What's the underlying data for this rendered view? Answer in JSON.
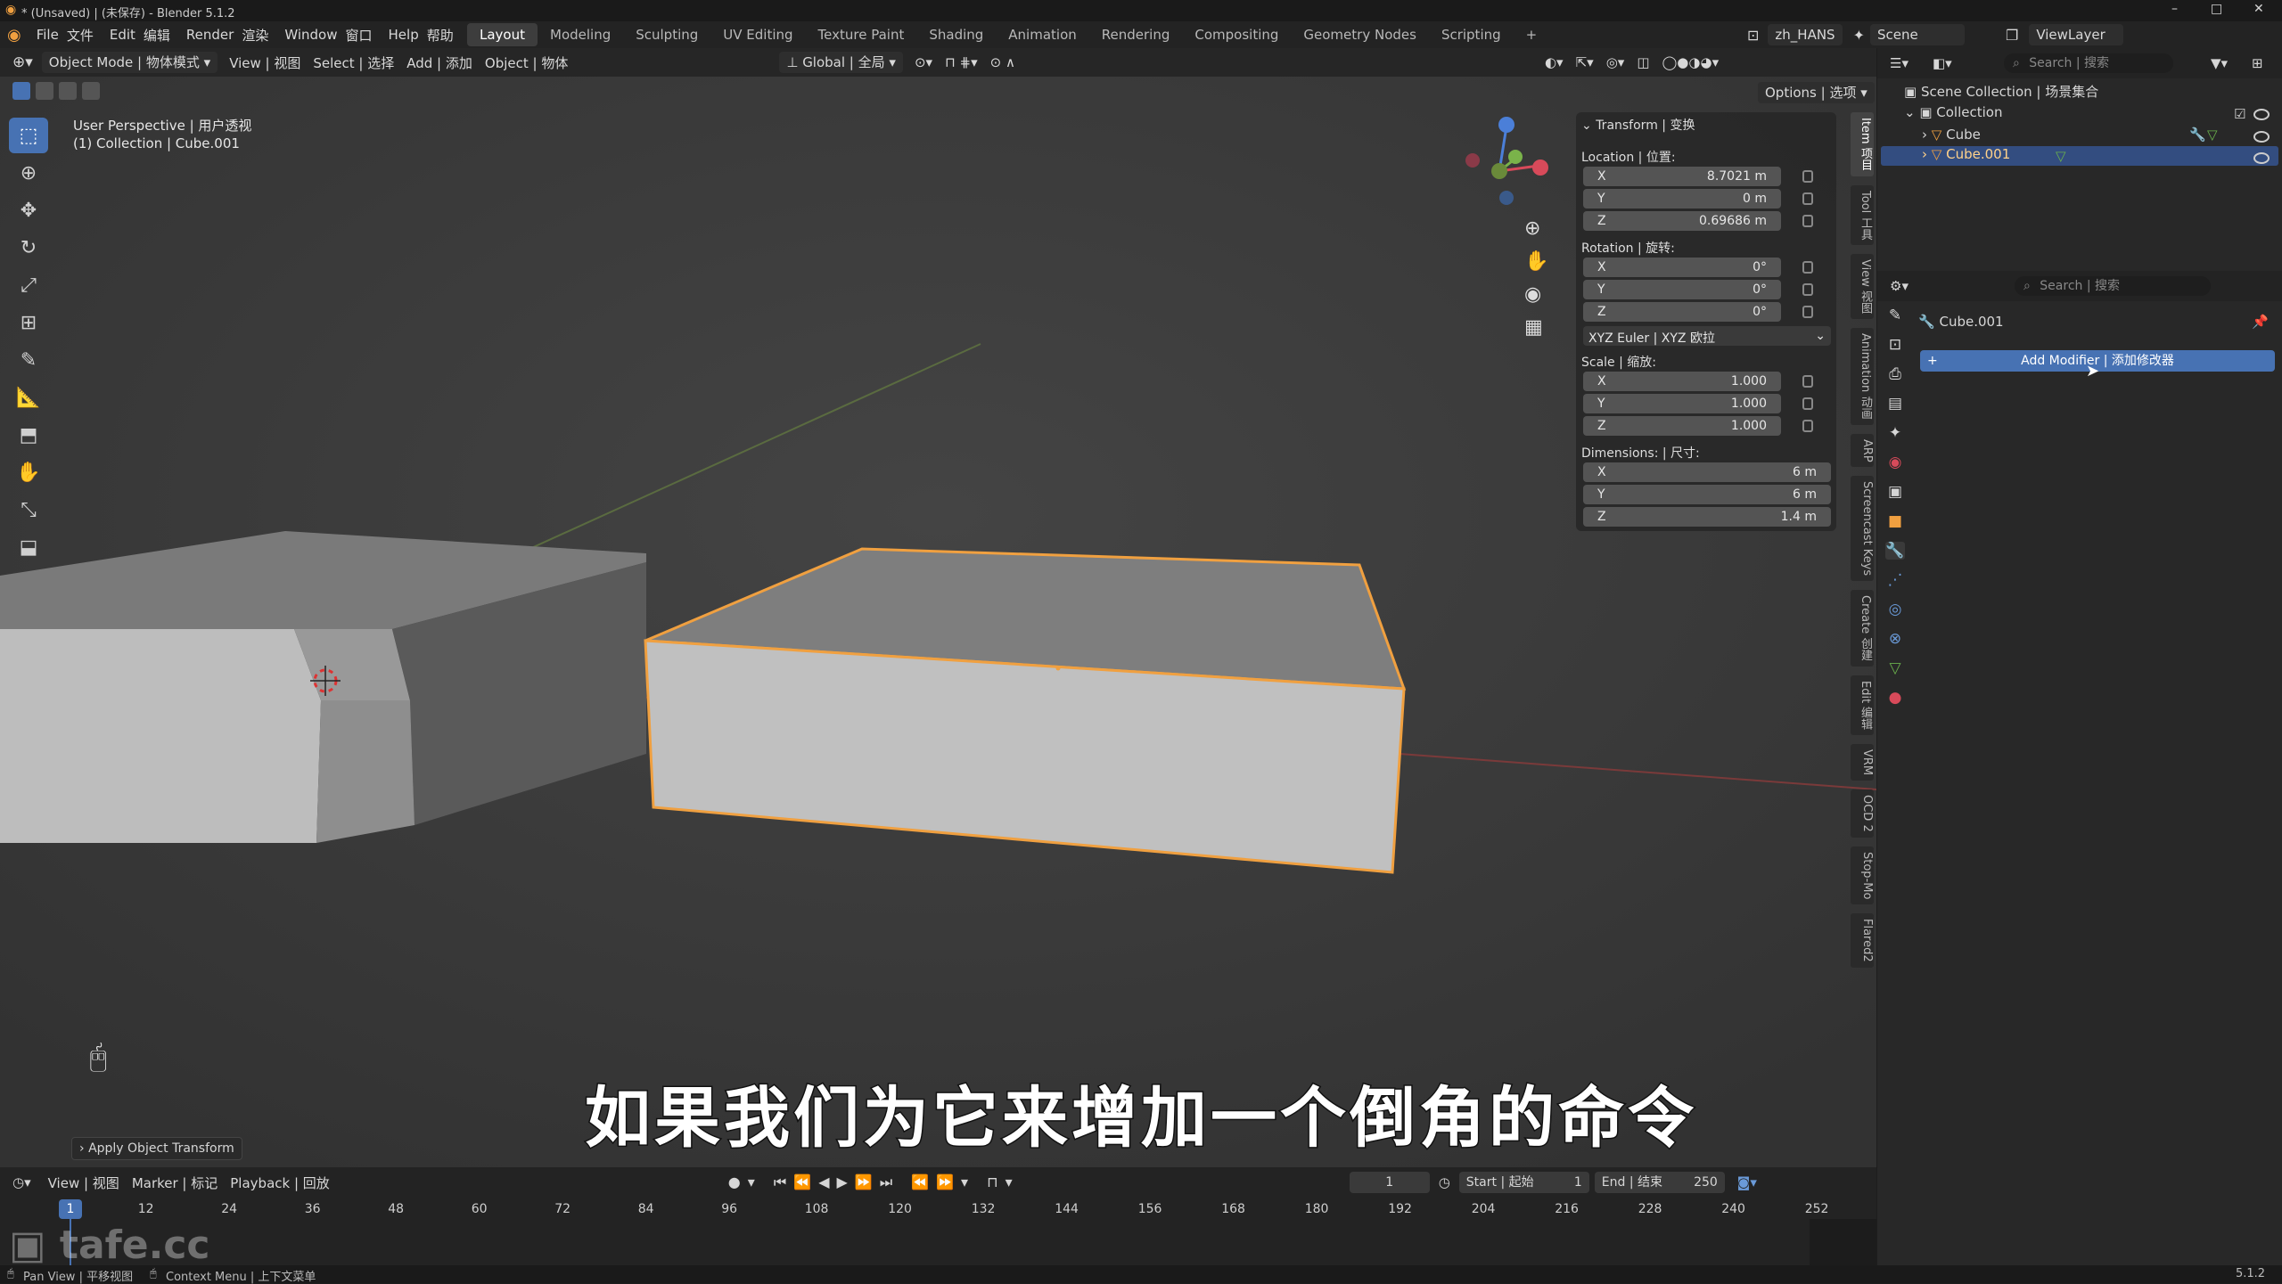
{
  "window": {
    "title": "* (Unsaved) | (未保存) - Blender 5.1.2",
    "controls": [
      "–",
      "□",
      "✕"
    ]
  },
  "menu": {
    "items": [
      "File",
      "文件",
      "Edit",
      "编辑",
      "Render",
      "渲染",
      "Window",
      "窗口",
      "Help",
      "帮助"
    ],
    "workspaces": [
      "Layout",
      "Modeling",
      "Sculpting",
      "UV Editing",
      "Texture Paint",
      "Shading",
      "Animation",
      "Rendering",
      "Compositing",
      "Geometry Nodes",
      "Scripting"
    ],
    "active_workspace": "Layout",
    "add_tab": "+",
    "language": "zh_HANS",
    "scene": "Scene",
    "view_layer": "ViewLayer"
  },
  "header": {
    "mode": "Object Mode | 物体模式",
    "menus": [
      "View | 视图",
      "Select | 选择",
      "Add | 添加",
      "Object | 物体"
    ],
    "transform_orientation": "Global | 全局",
    "options": "Options | 选项"
  },
  "viewport": {
    "view_name": "User Perspective | 用户透视",
    "collection_info": "(1) Collection | Cube.001",
    "last_op": "Apply Object Transform"
  },
  "npanel": {
    "section": "Transform | 变换",
    "location_label": "Location | 位置:",
    "location": [
      {
        "axis": "X",
        "value": "8.7021 m"
      },
      {
        "axis": "Y",
        "value": "0 m"
      },
      {
        "axis": "Z",
        "value": "0.69686 m"
      }
    ],
    "rotation_label": "Rotation | 旋转:",
    "rotation": [
      {
        "axis": "X",
        "value": "0°"
      },
      {
        "axis": "Y",
        "value": "0°"
      },
      {
        "axis": "Z",
        "value": "0°"
      }
    ],
    "rotation_mode": "XYZ Euler | XYZ 欧拉",
    "scale_label": "Scale | 缩放:",
    "scale": [
      {
        "axis": "X",
        "value": "1.000"
      },
      {
        "axis": "Y",
        "value": "1.000"
      },
      {
        "axis": "Z",
        "value": "1.000"
      }
    ],
    "dimensions_label": "Dimensions: | 尺寸:",
    "dimensions": [
      {
        "axis": "X",
        "value": "6 m"
      },
      {
        "axis": "Y",
        "value": "6 m"
      },
      {
        "axis": "Z",
        "value": "1.4 m"
      }
    ],
    "tabs": [
      "Item 项目",
      "Tool 工具",
      "View 视图",
      "Animation 动画",
      "ARP",
      "Screencast Keys",
      "Create 创建",
      "Edit 编辑",
      "VRM",
      "OCD 2",
      "Stop-Mo",
      "Flared2"
    ]
  },
  "outliner": {
    "search_placeholder": "Search | 搜索",
    "root": "Scene Collection | 场景集合",
    "collection": "Collection",
    "objects": [
      "Cube",
      "Cube.001"
    ]
  },
  "properties": {
    "search_placeholder": "Search | 搜索",
    "object_name": "Cube.001",
    "add_modifier": "Add Modifier | 添加修改器"
  },
  "timeline": {
    "menus": [
      "View | 视图",
      "Marker | 标记",
      "Playback | 回放"
    ],
    "current_frame": "1",
    "start_label": "Start | 起始",
    "start": "1",
    "end_label": "End | 结束",
    "end": "250",
    "ruler": [
      "1",
      "12",
      "24",
      "36",
      "48",
      "60",
      "72",
      "84",
      "96",
      "108",
      "120",
      "132",
      "144",
      "156",
      "168",
      "180",
      "192",
      "204",
      "216",
      "228",
      "240",
      "252"
    ]
  },
  "status": {
    "left": "Pan View | 平移视图",
    "mid": "Context Menu | 上下文菜单",
    "version": "5.1.2"
  },
  "watermark": "tafe.cc",
  "subtitle": "如果我们为它来增加一个倒角的命令",
  "colors": {
    "accent": "#4772b3",
    "selection": "#f0a040",
    "bg_viewport": "#3b3b3b"
  }
}
